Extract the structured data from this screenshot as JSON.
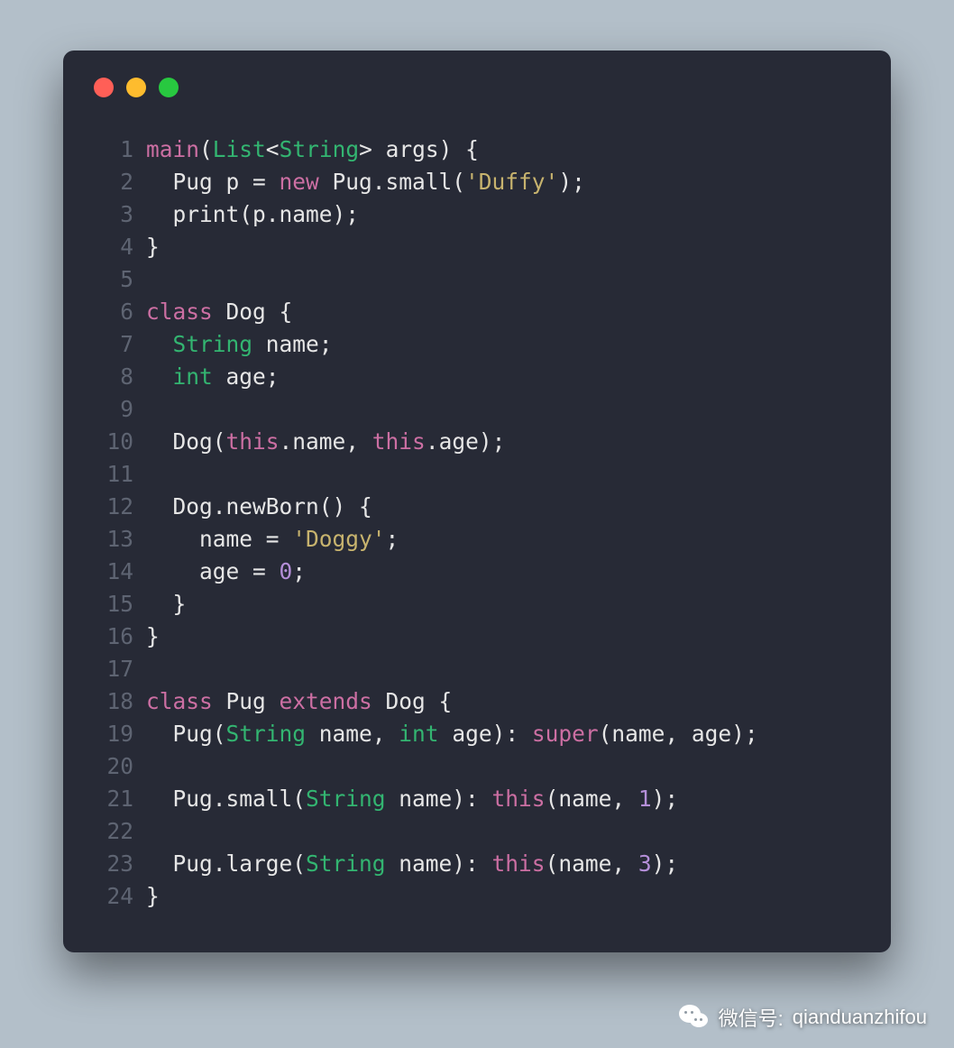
{
  "watermark": {
    "label": "微信号:",
    "handle": "qianduanzhifou"
  },
  "colors": {
    "red": "#ff5f57",
    "yellow": "#febc2e",
    "green": "#28c840"
  },
  "code_lines": [
    {
      "n": "1",
      "tokens": [
        {
          "t": "main",
          "c": "t-kw"
        },
        {
          "t": "(",
          "c": "t-default"
        },
        {
          "t": "List",
          "c": "t-type"
        },
        {
          "t": "<",
          "c": "t-default"
        },
        {
          "t": "String",
          "c": "t-type"
        },
        {
          "t": "> args) {",
          "c": "t-default"
        }
      ]
    },
    {
      "n": "2",
      "tokens": [
        {
          "t": "  Pug p = ",
          "c": "t-default"
        },
        {
          "t": "new",
          "c": "t-kw"
        },
        {
          "t": " Pug.small(",
          "c": "t-default"
        },
        {
          "t": "'Duffy'",
          "c": "t-str"
        },
        {
          "t": ");",
          "c": "t-default"
        }
      ]
    },
    {
      "n": "3",
      "tokens": [
        {
          "t": "  print(p.name);",
          "c": "t-default"
        }
      ]
    },
    {
      "n": "4",
      "tokens": [
        {
          "t": "}",
          "c": "t-default"
        }
      ]
    },
    {
      "n": "5",
      "tokens": [
        {
          "t": "",
          "c": "t-default"
        }
      ]
    },
    {
      "n": "6",
      "tokens": [
        {
          "t": "class",
          "c": "t-kw"
        },
        {
          "t": " Dog {",
          "c": "t-default"
        }
      ]
    },
    {
      "n": "7",
      "tokens": [
        {
          "t": "  ",
          "c": "t-default"
        },
        {
          "t": "String",
          "c": "t-type"
        },
        {
          "t": " name;",
          "c": "t-default"
        }
      ]
    },
    {
      "n": "8",
      "tokens": [
        {
          "t": "  ",
          "c": "t-default"
        },
        {
          "t": "int",
          "c": "t-type"
        },
        {
          "t": " age;",
          "c": "t-default"
        }
      ]
    },
    {
      "n": "9",
      "tokens": [
        {
          "t": "",
          "c": "t-default"
        }
      ]
    },
    {
      "n": "10",
      "tokens": [
        {
          "t": "  Dog(",
          "c": "t-default"
        },
        {
          "t": "this",
          "c": "t-kw"
        },
        {
          "t": ".name, ",
          "c": "t-default"
        },
        {
          "t": "this",
          "c": "t-kw"
        },
        {
          "t": ".age);",
          "c": "t-default"
        }
      ]
    },
    {
      "n": "11",
      "tokens": [
        {
          "t": "",
          "c": "t-default"
        }
      ]
    },
    {
      "n": "12",
      "tokens": [
        {
          "t": "  Dog.newBorn() {",
          "c": "t-default"
        }
      ]
    },
    {
      "n": "13",
      "tokens": [
        {
          "t": "    name = ",
          "c": "t-default"
        },
        {
          "t": "'Doggy'",
          "c": "t-str"
        },
        {
          "t": ";",
          "c": "t-default"
        }
      ]
    },
    {
      "n": "14",
      "tokens": [
        {
          "t": "    age = ",
          "c": "t-default"
        },
        {
          "t": "0",
          "c": "t-num"
        },
        {
          "t": ";",
          "c": "t-default"
        }
      ]
    },
    {
      "n": "15",
      "tokens": [
        {
          "t": "  }",
          "c": "t-default"
        }
      ]
    },
    {
      "n": "16",
      "tokens": [
        {
          "t": "}",
          "c": "t-default"
        }
      ]
    },
    {
      "n": "17",
      "tokens": [
        {
          "t": "",
          "c": "t-default"
        }
      ]
    },
    {
      "n": "18",
      "tokens": [
        {
          "t": "class",
          "c": "t-kw"
        },
        {
          "t": " Pug ",
          "c": "t-default"
        },
        {
          "t": "extends",
          "c": "t-kw"
        },
        {
          "t": " Dog {",
          "c": "t-default"
        }
      ]
    },
    {
      "n": "19",
      "tokens": [
        {
          "t": "  Pug(",
          "c": "t-default"
        },
        {
          "t": "String",
          "c": "t-type"
        },
        {
          "t": " name, ",
          "c": "t-default"
        },
        {
          "t": "int",
          "c": "t-type"
        },
        {
          "t": " age): ",
          "c": "t-default"
        },
        {
          "t": "super",
          "c": "t-kw"
        },
        {
          "t": "(name, age);",
          "c": "t-default"
        }
      ]
    },
    {
      "n": "20",
      "tokens": [
        {
          "t": "",
          "c": "t-default"
        }
      ]
    },
    {
      "n": "21",
      "tokens": [
        {
          "t": "  Pug.small(",
          "c": "t-default"
        },
        {
          "t": "String",
          "c": "t-type"
        },
        {
          "t": " name): ",
          "c": "t-default"
        },
        {
          "t": "this",
          "c": "t-kw"
        },
        {
          "t": "(name, ",
          "c": "t-default"
        },
        {
          "t": "1",
          "c": "t-num"
        },
        {
          "t": ");",
          "c": "t-default"
        }
      ]
    },
    {
      "n": "22",
      "tokens": [
        {
          "t": "",
          "c": "t-default"
        }
      ]
    },
    {
      "n": "23",
      "tokens": [
        {
          "t": "  Pug.large(",
          "c": "t-default"
        },
        {
          "t": "String",
          "c": "t-type"
        },
        {
          "t": " name): ",
          "c": "t-default"
        },
        {
          "t": "this",
          "c": "t-kw"
        },
        {
          "t": "(name, ",
          "c": "t-default"
        },
        {
          "t": "3",
          "c": "t-num"
        },
        {
          "t": ");",
          "c": "t-default"
        }
      ]
    },
    {
      "n": "24",
      "tokens": [
        {
          "t": "}",
          "c": "t-default"
        }
      ]
    }
  ]
}
